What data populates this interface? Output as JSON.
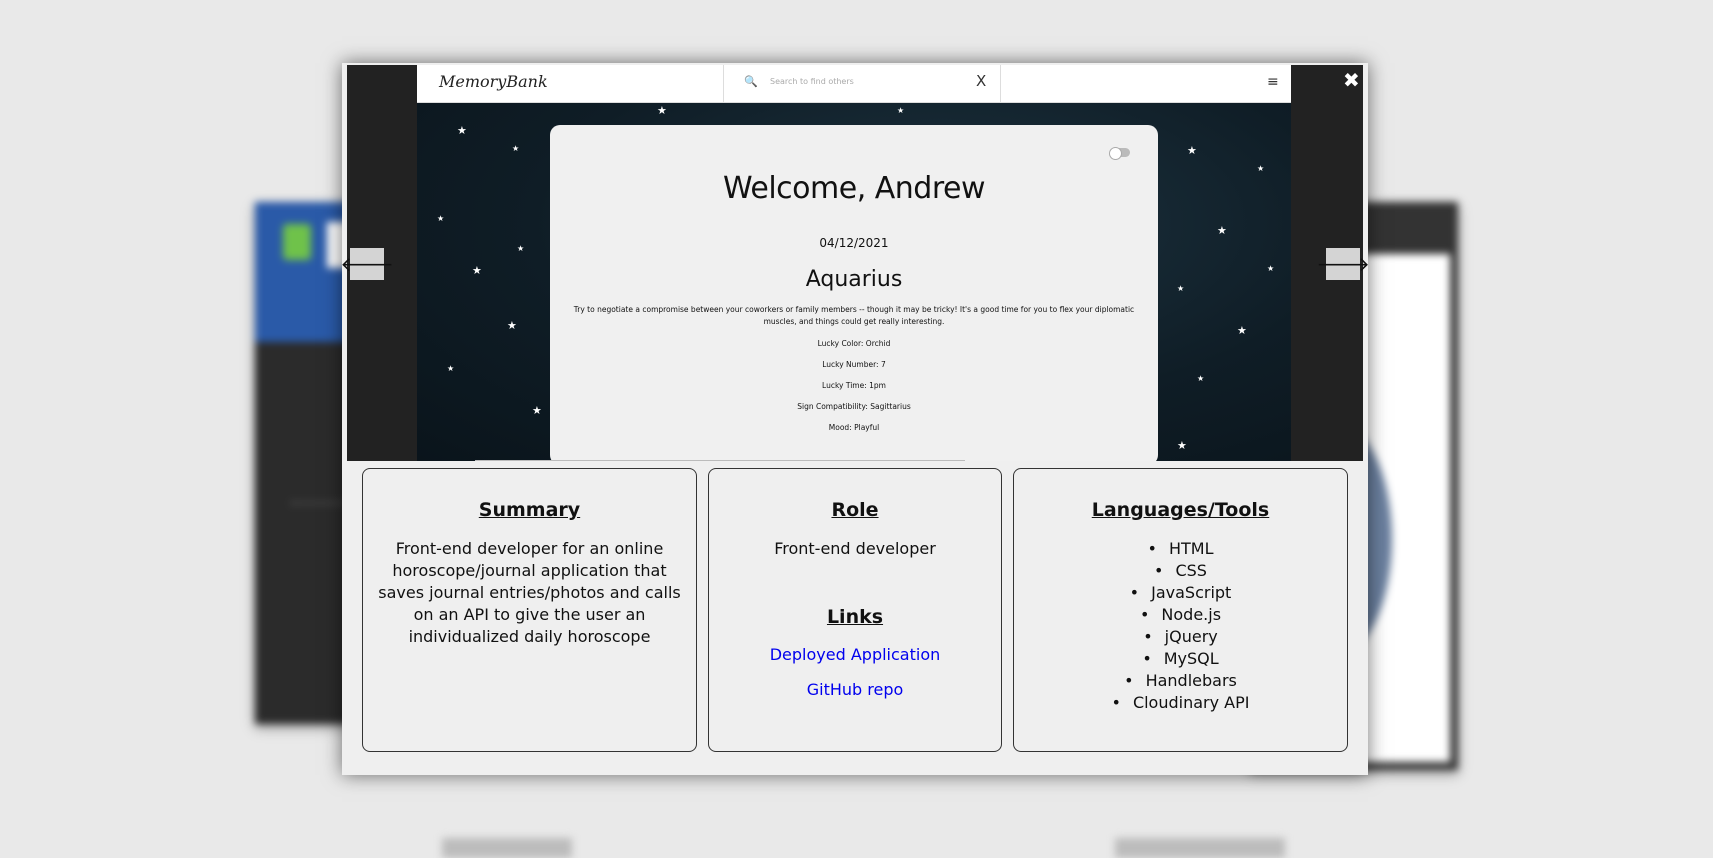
{
  "modal": {
    "close_glyph": "✖",
    "prev_glyph": "🡐",
    "next_glyph": "🡒"
  },
  "screenshot": {
    "brand": "MemoryBank",
    "search_placeholder": "Search to find others",
    "search_clear_glyph": "X",
    "menu_glyph": "≡",
    "welcome": "Welcome, Andrew",
    "date": "04/12/2021",
    "sign": "Aquarius",
    "reading": "Try to negotiate a compromise between your coworkers or family members -- though it may be tricky! It's a good time for you to flex your diplomatic muscles, and things could get really interesting.",
    "details": [
      "Lucky Color: Orchid",
      "Lucky Number: 7",
      "Lucky Time: 1pm",
      "Sign Compatibility: Sagittarius",
      "Mood: Playful"
    ]
  },
  "summary": {
    "heading": "Summary",
    "text": "Front-end developer for an online horoscope/journal application that saves journal entries/photos and calls on an API to give the user an individualized daily horoscope"
  },
  "role": {
    "heading": "Role",
    "text": "Front-end developer",
    "links_heading": "Links",
    "links": [
      "Deployed Application",
      "GitHub repo"
    ]
  },
  "tools": {
    "heading": "Languages/Tools",
    "items": [
      "HTML",
      "CSS",
      "JavaScript",
      "Node.js",
      "jQuery",
      "MySQL",
      "Handlebars",
      "Cloudinary API"
    ]
  },
  "colors": {
    "link": "#0000ee",
    "modal_bg": "#efefef",
    "viewer_bg": "#222222"
  }
}
